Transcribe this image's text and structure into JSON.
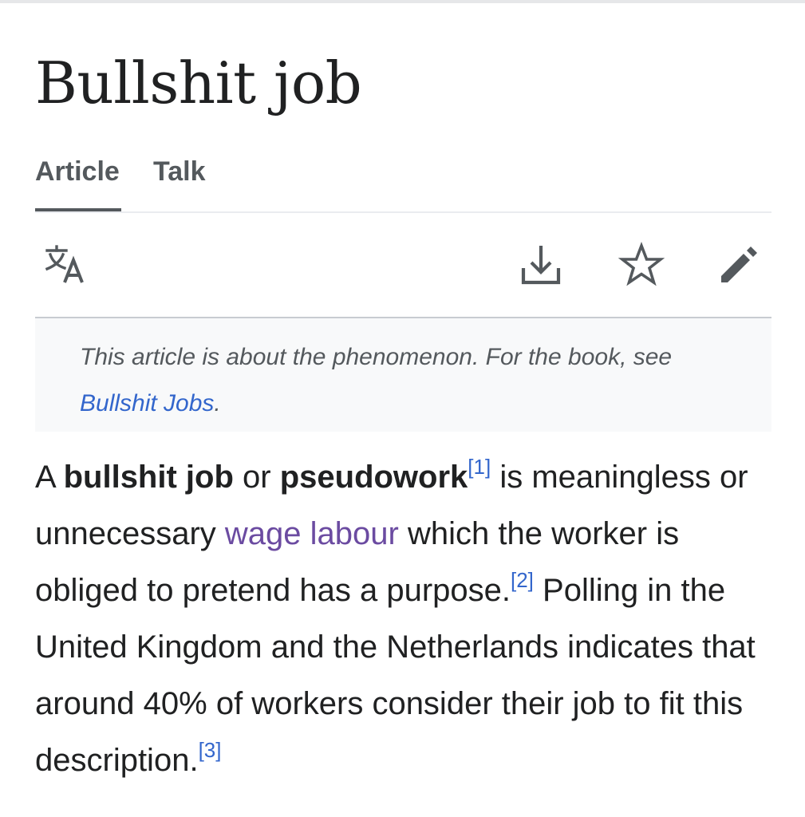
{
  "page": {
    "title": "Bullshit job"
  },
  "tabs": [
    {
      "label": "Article",
      "selected": true
    },
    {
      "label": "Talk",
      "selected": false
    }
  ],
  "toolbar": {
    "icons": [
      "language-icon",
      "download-icon",
      "star-icon",
      "edit-icon"
    ]
  },
  "hatnote": {
    "text": "This article is about the phenomenon. For the book, see ",
    "link": "Bullshit Jobs",
    "end": "."
  },
  "lead": {
    "p1": "A ",
    "term1": "bullshit job",
    "p2": " or ",
    "term2": "pseudowork",
    "ref1": "[1]",
    "p3": " is meaningless or unnecessary ",
    "link_wage": "wage labour",
    "p4": " which the worker is obliged to pretend has a purpose.",
    "ref2": "[2]",
    "p5": " Polling in the United Kingdom and the Netherlands indicates that around 40% of workers consider their job to fit this description.",
    "ref3": "[3]"
  },
  "colors": {
    "text": "#202122",
    "secondary": "#54595d",
    "link": "#3366cc",
    "visited_link": "#6b4ba1",
    "hatnote_bg": "#f8f9fa"
  }
}
